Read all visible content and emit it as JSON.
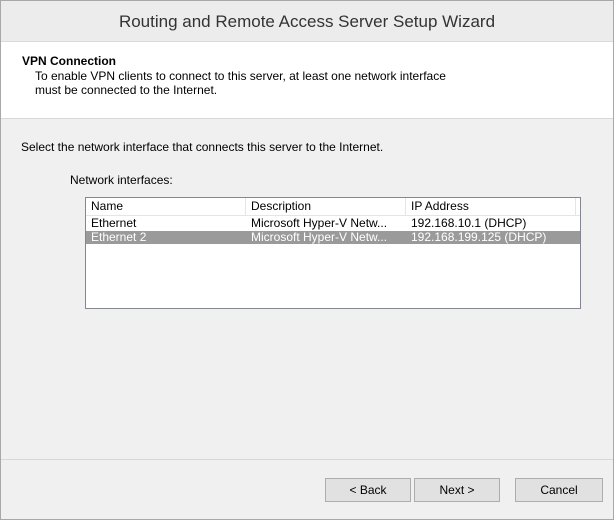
{
  "window": {
    "title": "Routing and Remote Access Server Setup Wizard"
  },
  "header": {
    "title": "VPN Connection",
    "description_line1": "To enable VPN clients to connect to this server, at least one network interface",
    "description_line2": "must be connected to the Internet."
  },
  "content": {
    "instruction": "Select the network interface that connects this server to the Internet.",
    "list_label": "Network interfaces:"
  },
  "list": {
    "columns": [
      "Name",
      "Description",
      "IP Address"
    ],
    "rows": [
      [
        "Ethernet",
        "Microsoft Hyper-V Netw...",
        "192.168.10.1 (DHCP)"
      ],
      [
        "Ethernet 2",
        "Microsoft Hyper-V Netw...",
        "192.168.199.125 (DHCP)"
      ]
    ],
    "selected_row": 1
  },
  "buttons": {
    "back": "< Back",
    "next": "Next >",
    "cancel": "Cancel"
  }
}
